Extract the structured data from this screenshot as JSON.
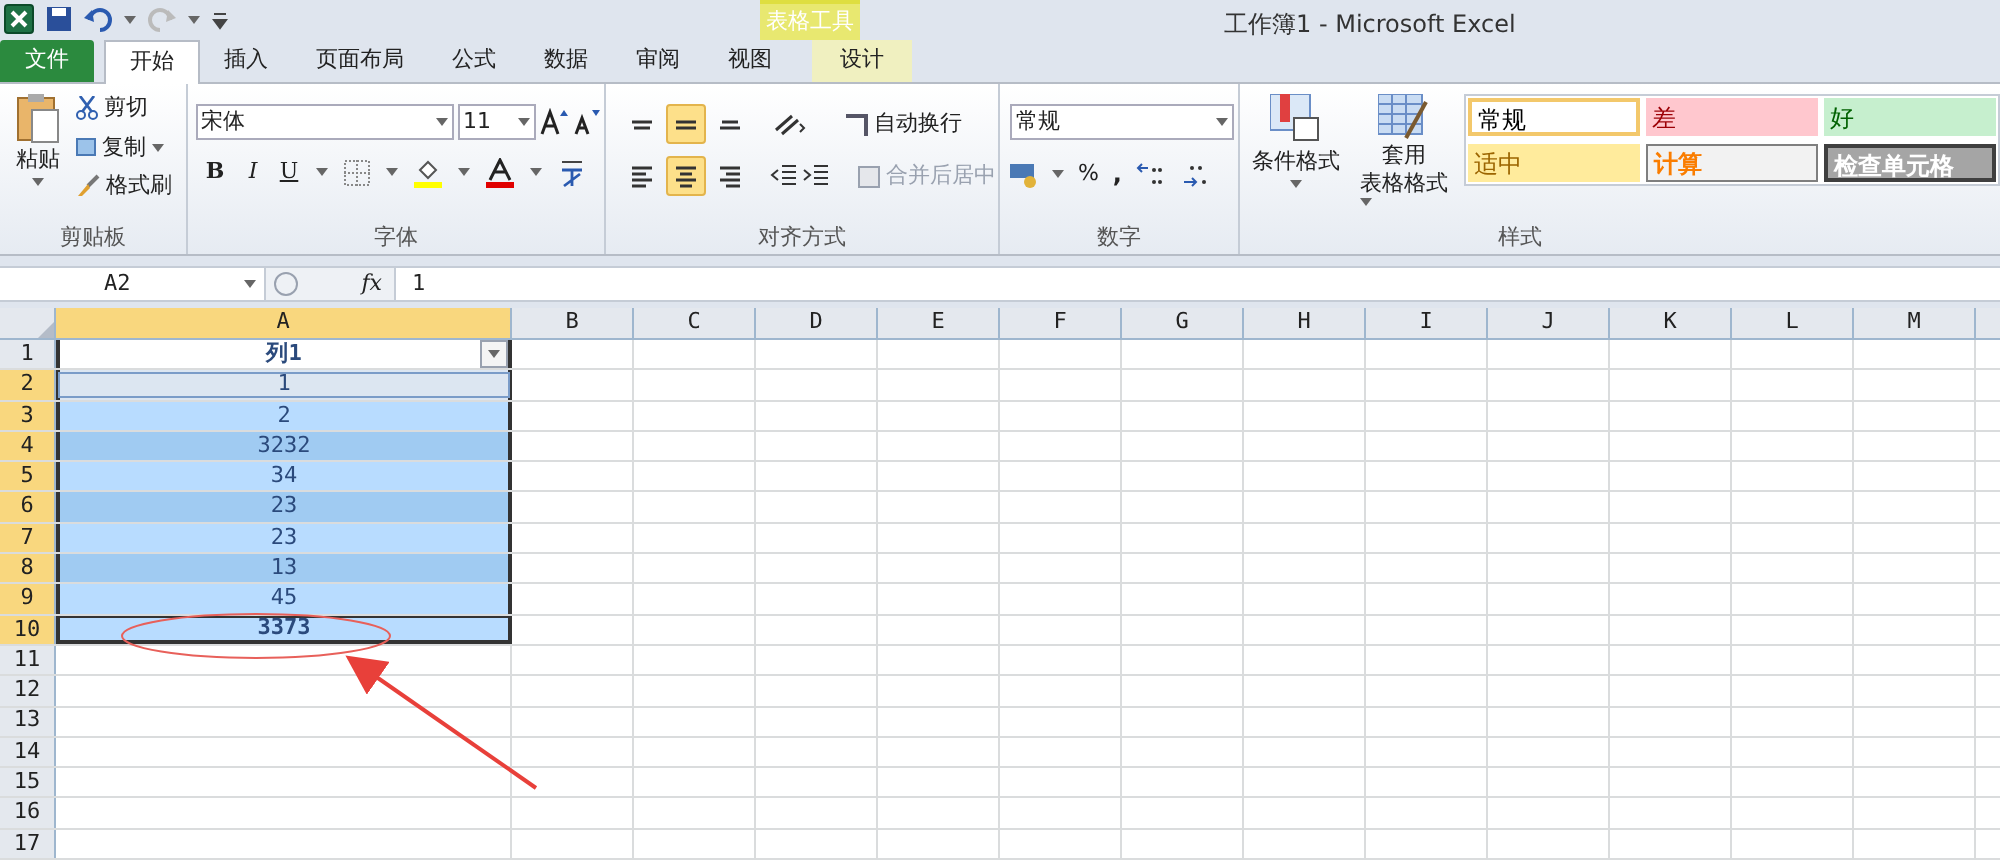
{
  "window": {
    "title": "工作簿1 - Microsoft Excel",
    "context_group": "表格工具"
  },
  "tabs": [
    {
      "label": "文件",
      "kind": "file",
      "selected": false
    },
    {
      "label": "开始",
      "kind": "normal",
      "selected": true
    },
    {
      "label": "插入",
      "kind": "normal",
      "selected": false
    },
    {
      "label": "页面布局",
      "kind": "normal",
      "selected": false
    },
    {
      "label": "公式",
      "kind": "normal",
      "selected": false
    },
    {
      "label": "数据",
      "kind": "normal",
      "selected": false
    },
    {
      "label": "审阅",
      "kind": "normal",
      "selected": false
    },
    {
      "label": "视图",
      "kind": "normal",
      "selected": false
    },
    {
      "label": "设计",
      "kind": "contextual",
      "selected": false
    }
  ],
  "ribbon": {
    "clipboard": {
      "paste": "粘贴",
      "cut": "剪切",
      "copy": "复制",
      "format_painter": "格式刷",
      "label": "剪贴板"
    },
    "font": {
      "font_name": "宋体",
      "font_size": "11",
      "bold": "B",
      "italic": "I",
      "underline": "U",
      "label": "字体"
    },
    "alignment": {
      "vertical": [
        {
          "kind": "top",
          "selected": false
        },
        {
          "kind": "middle",
          "selected": true
        },
        {
          "kind": "bottom",
          "selected": false
        }
      ],
      "horizontal": [
        {
          "kind": "left",
          "selected": false
        },
        {
          "kind": "center",
          "selected": true
        },
        {
          "kind": "right",
          "selected": false
        }
      ],
      "wrap_text": {
        "label": "自动换行",
        "disabled": false
      },
      "merge_center": {
        "label": "合并后居中",
        "disabled": true
      },
      "label": "对齐方式"
    },
    "number": {
      "format": "常规",
      "percent": "%",
      "comma": ",",
      "label": "数字"
    },
    "styles": {
      "conditional": "条件格式",
      "table_format_1": "套用",
      "table_format_2": "表格格式",
      "label": "样式",
      "cells": [
        {
          "label": "常规",
          "kind": "normal"
        },
        {
          "label": "差",
          "kind": "bad"
        },
        {
          "label": "好",
          "kind": "good"
        },
        {
          "label": "适中",
          "kind": "neutral"
        },
        {
          "label": "计算",
          "kind": "calc"
        },
        {
          "label": "检查单元格",
          "kind": "check"
        }
      ]
    }
  },
  "formula_bar": {
    "name_box": "A2",
    "fx": "fx",
    "formula": "1"
  },
  "sheet": {
    "columns": [
      {
        "label": "A",
        "selected": true
      },
      {
        "label": "B",
        "selected": false
      },
      {
        "label": "C",
        "selected": false
      },
      {
        "label": "D",
        "selected": false
      },
      {
        "label": "E",
        "selected": false
      },
      {
        "label": "F",
        "selected": false
      },
      {
        "label": "G",
        "selected": false
      },
      {
        "label": "H",
        "selected": false
      },
      {
        "label": "I",
        "selected": false
      },
      {
        "label": "J",
        "selected": false
      },
      {
        "label": "K",
        "selected": false
      },
      {
        "label": "L",
        "selected": false
      },
      {
        "label": "M",
        "selected": false
      }
    ],
    "rows": [
      {
        "label": "1",
        "selected": false,
        "kind": "header",
        "value": "列1"
      },
      {
        "label": "2",
        "selected": true,
        "kind": "data",
        "value": "1",
        "active": true
      },
      {
        "label": "3",
        "selected": true,
        "kind": "data",
        "value": "2",
        "active": false
      },
      {
        "label": "4",
        "selected": true,
        "kind": "data",
        "value": "3232",
        "active": false
      },
      {
        "label": "5",
        "selected": true,
        "kind": "data",
        "value": "34",
        "active": false
      },
      {
        "label": "6",
        "selected": true,
        "kind": "data",
        "value": "23",
        "active": false
      },
      {
        "label": "7",
        "selected": true,
        "kind": "data",
        "value": "23",
        "active": false
      },
      {
        "label": "8",
        "selected": true,
        "kind": "data",
        "value": "13",
        "active": false
      },
      {
        "label": "9",
        "selected": true,
        "kind": "data",
        "value": "45",
        "active": false
      },
      {
        "label": "10",
        "selected": true,
        "kind": "total",
        "value": "3373",
        "active": false
      },
      {
        "label": "11",
        "selected": false,
        "kind": "empty"
      },
      {
        "label": "12",
        "selected": false,
        "kind": "empty"
      },
      {
        "label": "13",
        "selected": false,
        "kind": "empty"
      },
      {
        "label": "14",
        "selected": false,
        "kind": "empty"
      },
      {
        "label": "15",
        "selected": false,
        "kind": "empty"
      },
      {
        "label": "16",
        "selected": false,
        "kind": "empty"
      },
      {
        "label": "17",
        "selected": false,
        "kind": "empty"
      }
    ]
  }
}
